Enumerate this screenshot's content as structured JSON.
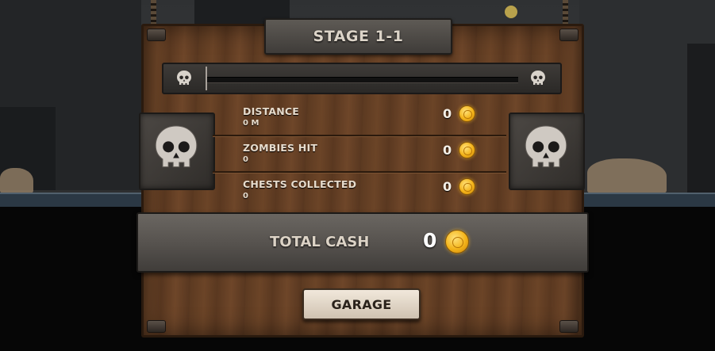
{
  "header": {
    "title": "STAGE 1-1"
  },
  "progress": {
    "value": 0
  },
  "stats": [
    {
      "label": "DISTANCE",
      "sub": "0 M",
      "value": "0",
      "icon": "coin-icon"
    },
    {
      "label": "ZOMBIES HIT",
      "sub": "0",
      "value": "0",
      "icon": "coin-icon"
    },
    {
      "label": "CHESTS COLLECTED",
      "sub": "0",
      "value": "0",
      "icon": "coin-icon"
    }
  ],
  "total": {
    "label": "TOTAL CASH",
    "value": "0",
    "icon": "coin-icon"
  },
  "button": {
    "label": "GARAGE"
  },
  "icons": {
    "progress_left": "skull-icon",
    "progress_right": "skull-icon",
    "plate_left": "skull-icon",
    "plate_right": "skull-icon"
  },
  "colors": {
    "panel_wood": "#6b4427",
    "coin_gold": "#f3b319",
    "button_bg": "#f1e8db",
    "text_light": "#e7dccd"
  }
}
